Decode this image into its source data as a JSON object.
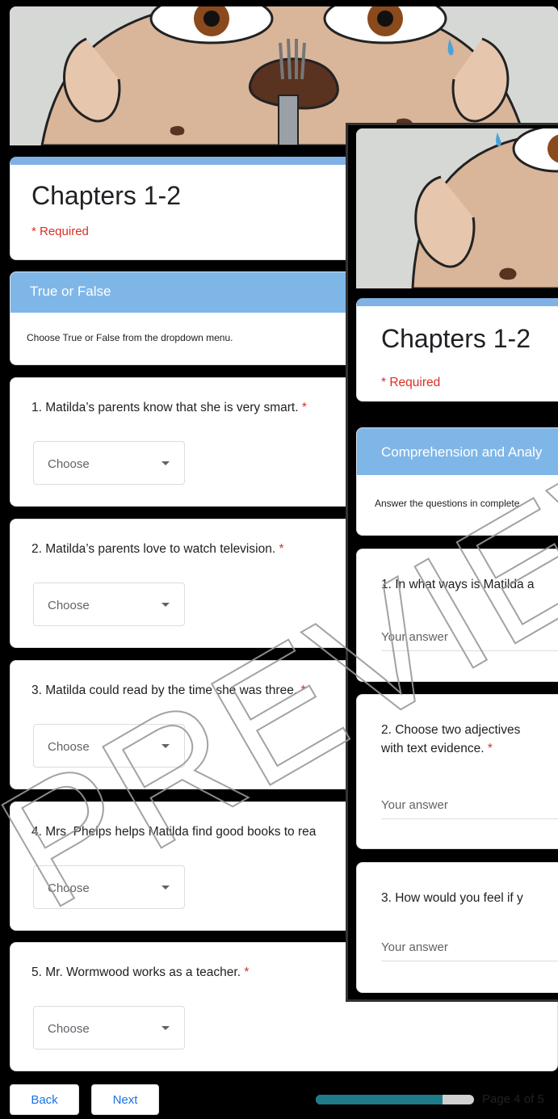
{
  "back_form": {
    "title": "Chapters 1-2",
    "required_note": "* Required",
    "section": {
      "header": "True or False",
      "description": "Choose True or False from the dropdown menu."
    },
    "questions": [
      {
        "text": "1. Matilda’s parents know that she is very smart.",
        "star": "*",
        "dropdown": "Choose"
      },
      {
        "text": "2. Matilda’s parents love to watch television.",
        "star": "*",
        "dropdown": "Choose"
      },
      {
        "text": "3. Matilda could read by the time she was three.",
        "star": "*",
        "dropdown": "Choose"
      },
      {
        "text": "4. Mrs. Phelps helps Matilda find good books to rea",
        "star": "",
        "dropdown": "Choose"
      },
      {
        "text": "5. Mr. Wormwood works as a teacher.",
        "star": "*",
        "dropdown": "Choose"
      }
    ],
    "nav": {
      "back_label": "Back",
      "next_label": "Next",
      "progress_fraction": 0.8,
      "page_indicator": "Page 4 of 5"
    }
  },
  "front_form": {
    "title": "Chapters 1-2",
    "required_note": "* Required",
    "section": {
      "header": "Comprehension and Analy",
      "description": "Answer the questions in complete"
    },
    "questions": [
      {
        "text": "1. In what ways is Matilda a",
        "answer_placeholder": "Your answer"
      },
      {
        "text": "2. Choose two adjectives",
        "text_line2": "with text evidence.",
        "star": "*",
        "answer_placeholder": "Your answer"
      },
      {
        "text": "3. How would you feel if y",
        "answer_placeholder": "Your answer"
      }
    ]
  },
  "watermark": "PREVIEW",
  "colors": {
    "accent_blue": "#1a73e8",
    "section_header": "#7fb6e8",
    "required_red": "#d93025",
    "progress_fill": "#1e7b8a"
  }
}
